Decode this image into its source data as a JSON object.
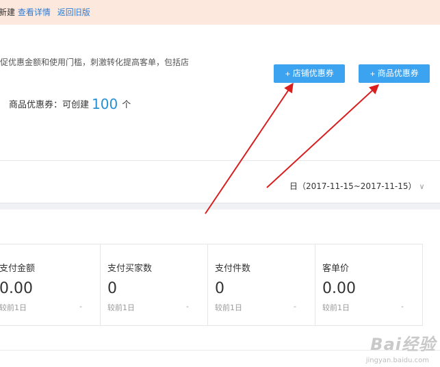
{
  "notice": {
    "text": "新建",
    "link_details": "查看详情",
    "link_old": "返回旧版"
  },
  "description": "促优惠金额和使用门槛，刺激转化提高客单，包括店",
  "buttons": {
    "plus": "+",
    "shop_coupon": "店铺优惠券",
    "product_coupon": "商品优惠券"
  },
  "quota": {
    "label": "商品优惠券：可创建",
    "count": "100",
    "unit": "个"
  },
  "date_range": {
    "label": "日（2017-11-15~2017-11-15）",
    "chevron": "∨"
  },
  "stats": [
    {
      "title": "支付金额",
      "value": "0.00",
      "compare": "较前1日",
      "change": "-"
    },
    {
      "title": "支付买家数",
      "value": "0",
      "compare": "较前1日",
      "change": "-"
    },
    {
      "title": "支付件数",
      "value": "0",
      "compare": "较前1日",
      "change": "-"
    },
    {
      "title": "客单价",
      "value": "0.00",
      "compare": "较前1日",
      "change": "-"
    }
  ],
  "watermark": {
    "text": "Bai经验",
    "url": "jingyan.baidu.com"
  },
  "colors": {
    "accent": "#3ba3f0",
    "link": "#2b7bd6",
    "arrow": "#d81e1e",
    "notice_bg": "#fde8dd"
  }
}
